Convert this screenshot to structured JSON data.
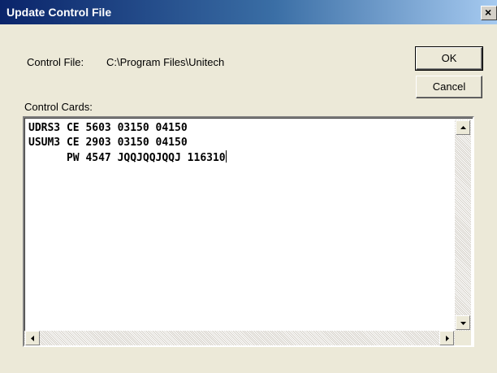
{
  "window": {
    "title": "Update Control File",
    "close_glyph": "×"
  },
  "control_file": {
    "label": "Control File:",
    "value": "C:\\Program Files\\Unitech"
  },
  "buttons": {
    "ok_label": "OK",
    "cancel_label": "Cancel"
  },
  "control_cards": {
    "label": "Control Cards:",
    "lines": [
      "UDRS3 CE 5603 03150 04150",
      "USUM3 CE 2903 03150 04150",
      "      PW 4547 JQQJQQJQQJ 116310"
    ]
  },
  "icons": {
    "scroll_up": "scroll-up-icon",
    "scroll_down": "scroll-down-icon",
    "scroll_left": "scroll-left-icon",
    "scroll_right": "scroll-right-icon"
  },
  "colors": {
    "titlebar_start": "#0a246a",
    "titlebar_end": "#a6caf0",
    "dialog_bg": "#ece9d8"
  }
}
